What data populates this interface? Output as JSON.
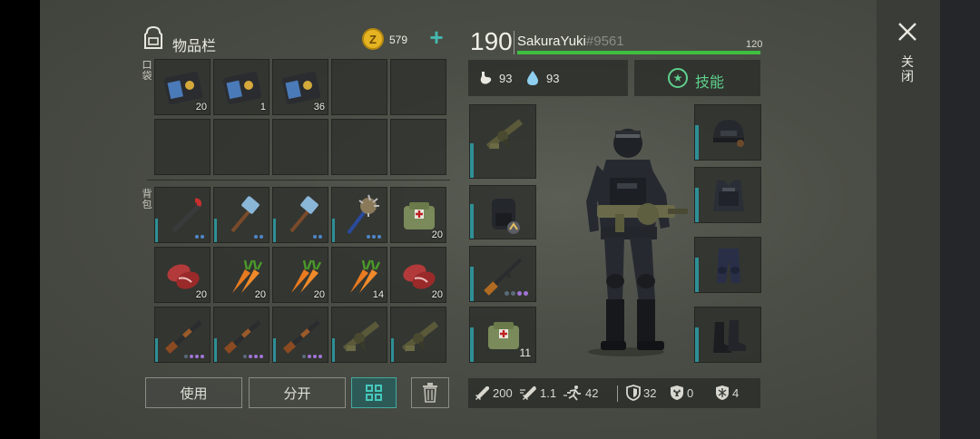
{
  "inventory": {
    "title": "物品栏",
    "coins": "579",
    "add_symbol": "+",
    "pocket_label": "口袋",
    "backpack_label": "背包",
    "pocket": [
      {
        "icon": "wallet-icon",
        "count": "20"
      },
      {
        "icon": "wallet-icon",
        "count": "1"
      },
      {
        "icon": "wallet-icon",
        "count": "36"
      }
    ],
    "backpack": [
      {
        "icon": "crowbar-icon",
        "count": ""
      },
      {
        "icon": "sledgehammer-icon",
        "count": ""
      },
      {
        "icon": "sledgehammer-icon",
        "count": ""
      },
      {
        "icon": "spiked-mace-icon",
        "count": ""
      },
      {
        "icon": "medkit-bag-icon",
        "count": "20"
      },
      {
        "icon": "raw-meat-icon",
        "count": "20"
      },
      {
        "icon": "carrot-icon",
        "count": "20"
      },
      {
        "icon": "carrot-icon",
        "count": "20"
      },
      {
        "icon": "carrot-icon",
        "count": "14"
      },
      {
        "icon": "raw-meat-icon",
        "count": "20"
      },
      {
        "icon": "shotgun-icon",
        "count": ""
      },
      {
        "icon": "shotgun-icon",
        "count": ""
      },
      {
        "icon": "shotgun-icon",
        "count": ""
      },
      {
        "icon": "grenade-launcher-icon",
        "count": ""
      },
      {
        "icon": "grenade-launcher-icon",
        "count": ""
      }
    ],
    "buttons": {
      "use": "使用",
      "split": "分开"
    }
  },
  "character": {
    "level": "190",
    "name": "SakuraYuki",
    "tag": "#9561",
    "xp_max": "120",
    "hunger": "93",
    "thirst": "93",
    "skills_label": "技能",
    "close_label": "关闭"
  },
  "equipment": {
    "left": [
      {
        "icon": "grenade-launcher-icon",
        "count": ""
      },
      {
        "icon": "backpack-icon",
        "count": ""
      },
      {
        "icon": "rifle-icon",
        "count": ""
      },
      {
        "icon": "medkit-bag-icon",
        "count": "11"
      }
    ],
    "right": [
      {
        "icon": "helmet-icon"
      },
      {
        "icon": "vest-icon"
      },
      {
        "icon": "pants-icon"
      },
      {
        "icon": "boots-icon"
      }
    ]
  },
  "stats": {
    "damage": "200",
    "attack_speed": "1.1",
    "speed": "42",
    "armor": "32",
    "radiation": "0",
    "cold": "4"
  },
  "colors": {
    "accent": "#45a9a0",
    "xp_bar": "#3fbf3f",
    "coin": "#e6b422"
  }
}
